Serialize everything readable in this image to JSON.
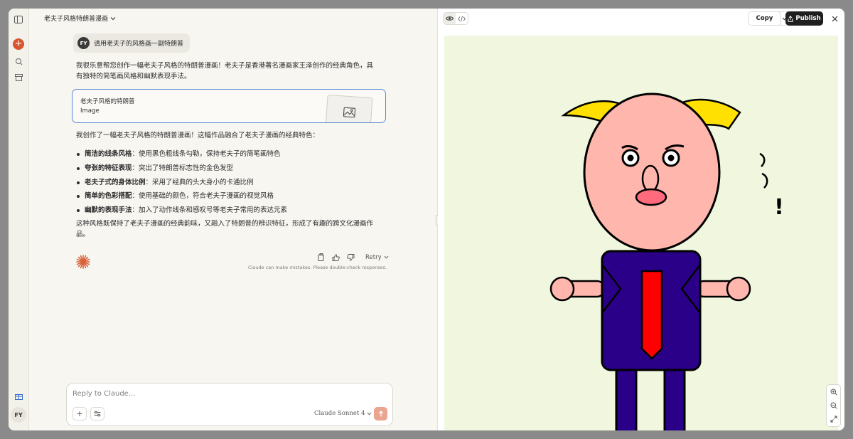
{
  "chat": {
    "title": "老夫子风格特朗普漫画",
    "user_initials": "FY",
    "user_message": "请用老夫子的风格画一副特朗普",
    "intro_paragraph": "我很乐意帮您创作一幅老夫子风格的特朗普漫画！老夫子是香港著名漫画家王泽创作的经典角色，具有独特的简笔画风格和幽默表现手法。",
    "artifact": {
      "title": "老夫子风格的特朗普",
      "type": "Image"
    },
    "summary_lead": "我创作了一幅老夫子风格的特朗普漫画！这幅作品融合了老夫子漫画的经典特色：",
    "bullets": [
      {
        "bold": "简洁的线条风格",
        "text": "：使用黑色粗线条勾勒，保持老夫子的简笔画特色"
      },
      {
        "bold": "夸张的特征表现",
        "text": "：突出了特朗普标志性的金色发型"
      },
      {
        "bold": "老夫子式的身体比例",
        "text": "：采用了经典的头大身小的卡通比例"
      },
      {
        "bold": "简单的色彩搭配",
        "text": "：使用基础的颜色，符合老夫子漫画的视觉风格"
      },
      {
        "bold": "幽默的表现手法",
        "text": "：加入了动作线条和感叹号等老夫子常用的表达元素"
      }
    ],
    "closing_paragraph": "这种风格既保持了老夫子漫画的经典韵味，又融入了特朗普的辨识特征，形成了有趣的跨文化漫画作品。",
    "retry_label": "Retry",
    "disclaimer": "Claude can make mistakes. Please double-check responses."
  },
  "composer": {
    "placeholder": "Reply to Claude...",
    "model_label": "Claude Sonnet 4"
  },
  "rail": {
    "user_initials": "FY"
  },
  "artifact_panel": {
    "copy_label": "Copy",
    "publish_label": "Publish",
    "drawing": {
      "exclamation": "!"
    }
  },
  "colors": {
    "accent": "#d9532f",
    "artifact_border": "#5b88d6",
    "canvas_bg": "#f1f7de",
    "hair": "#ffe000",
    "face": "#ffb6ad",
    "suit": "#2b0089",
    "tie": "#ff0000"
  },
  "icons": {
    "rail": [
      "sidebar-toggle-icon",
      "plus-icon",
      "search-icon",
      "archive-icon",
      "gift-icon"
    ],
    "message_actions": [
      "copy-icon",
      "thumbs-up-icon",
      "thumbs-down-icon",
      "chevron-down-icon"
    ],
    "panel": [
      "eye-icon",
      "code-icon",
      "share-icon",
      "close-icon",
      "zoom-in-icon",
      "zoom-out-icon",
      "expand-icon"
    ]
  }
}
